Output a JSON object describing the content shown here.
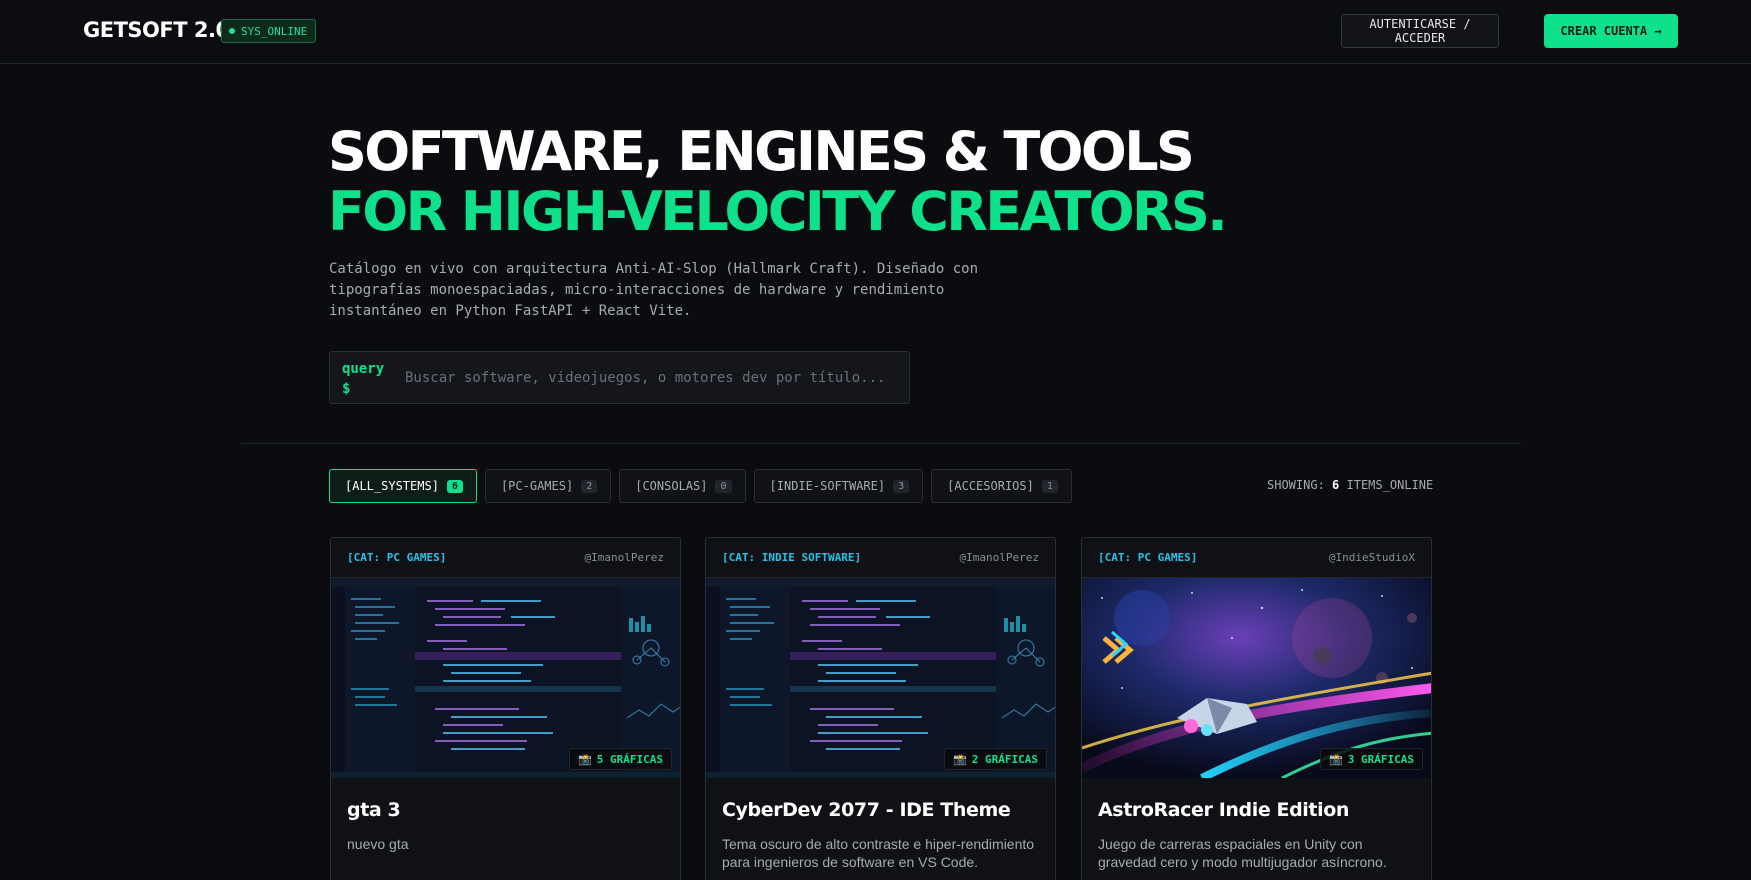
{
  "nav": {
    "logo": "GETSOFT 2.0",
    "status": "SYS_ONLINE",
    "login_label": "AUTENTICARSE / ACCEDER",
    "create_label": "CREAR CUENTA →"
  },
  "hero": {
    "title_line1": "SOFTWARE, ENGINES & TOOLS",
    "title_line2": "FOR HIGH-VELOCITY CREATORS.",
    "description": "Catálogo en vivo con arquitectura Anti-AI-Slop (Hallmark Craft). Diseñado con tipografías monoespaciadas, micro-interacciones de hardware y rendimiento instantáneo en Python FastAPI + React Vite."
  },
  "search": {
    "prompt_line1": "query",
    "prompt_line2": "$",
    "placeholder": "Buscar software, videojuegos, o motores dev por título...",
    "value": ""
  },
  "filters": [
    {
      "label": "[ALL_SYSTEMS]",
      "count": "6",
      "active": true
    },
    {
      "label": "[PC-GAMES]",
      "count": "2",
      "active": false
    },
    {
      "label": "[CONSOLAS]",
      "count": "0",
      "active": false
    },
    {
      "label": "[INDIE-SOFTWARE]",
      "count": "3",
      "active": false
    },
    {
      "label": "[ACCESORIOS]",
      "count": "1",
      "active": false
    }
  ],
  "showing": {
    "prefix": "SHOWING:",
    "count": "6",
    "suffix": "ITEMS_ONLINE"
  },
  "cards": [
    {
      "category": "[CAT: PC GAMES]",
      "author": "@ImanolPerez",
      "badge_icon": "📸",
      "badge": "5 GRÁFICAS",
      "title": "gta 3",
      "description": "nuevo gta",
      "thumb": "code-editor"
    },
    {
      "category": "[CAT: INDIE SOFTWARE]",
      "author": "@ImanolPerez",
      "badge_icon": "📸",
      "badge": "2 GRÁFICAS",
      "title": "CyberDev 2077 - IDE Theme",
      "description": "Tema oscuro de alto contraste e hiper-rendimiento para ingenieros de software en VS Code.",
      "thumb": "code-editor"
    },
    {
      "category": "[CAT: PC GAMES]",
      "author": "@IndieStudioX",
      "badge_icon": "📸",
      "badge": "3 GRÁFICAS",
      "title": "AstroRacer Indie Edition",
      "description": "Juego de carreras espaciales en Unity con gravedad cero y modo multijugador asíncrono.",
      "thumb": "space-racer"
    }
  ],
  "colors": {
    "accent": "#0fe08c",
    "category": "#22c3e8",
    "background": "#0b0c0f"
  }
}
